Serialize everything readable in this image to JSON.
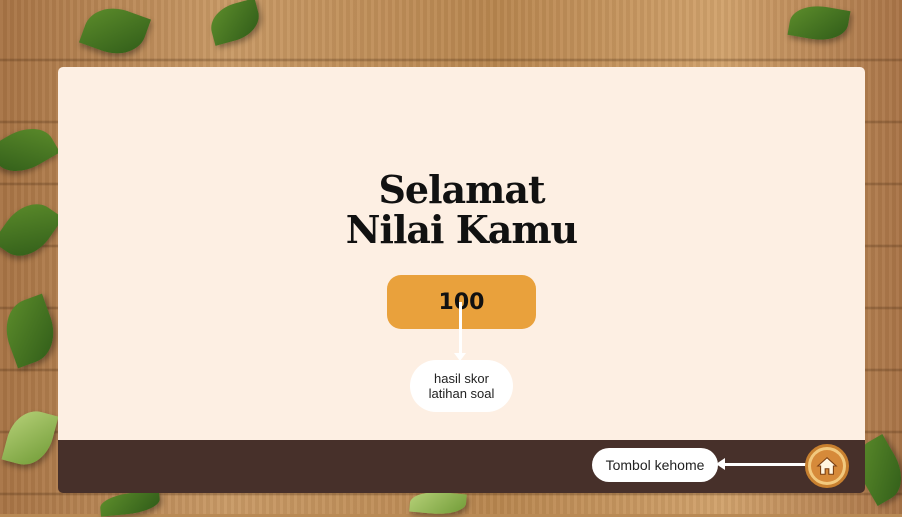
{
  "result": {
    "title_line1": "Selamat",
    "title_line2": "Nilai Kamu",
    "score": "100",
    "score_caption_line1": "hasil skor",
    "score_caption_line2": "latihan soal"
  },
  "footer": {
    "home_caption": "Tombol kehome",
    "home_icon": "home-icon"
  },
  "colors": {
    "card": "#fdefe3",
    "footer": "#47302a",
    "score_box": "#e9a13c",
    "home_button": "#f2c97e"
  }
}
